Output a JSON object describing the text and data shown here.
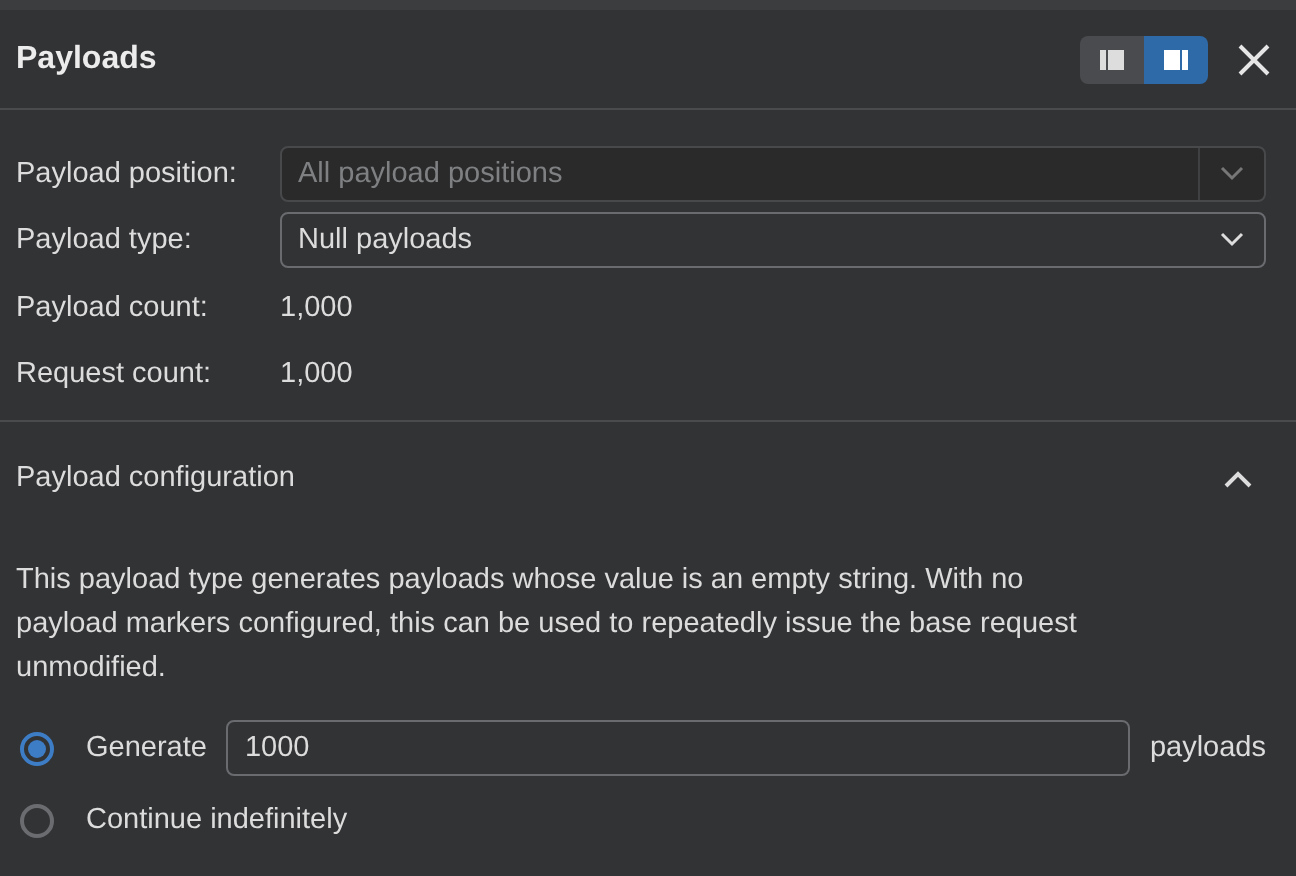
{
  "panel": {
    "title": "Payloads",
    "view_toggle": [
      {
        "selected": false
      },
      {
        "selected": true
      }
    ]
  },
  "fields": [
    {
      "kind": "select",
      "label": "Payload position:",
      "value": "All payload positions",
      "disabled": true
    },
    {
      "kind": "select",
      "label": "Payload type:",
      "value": "Null payloads",
      "disabled": false
    },
    {
      "kind": "text",
      "label": "Payload count:",
      "value": "1,000"
    },
    {
      "kind": "text",
      "label": "Request count:",
      "value": "1,000"
    }
  ],
  "section": {
    "title": "Payload configuration",
    "expanded": true,
    "description": "This payload type generates payloads whose value is an empty string. With no payload markers configured, this can be used to repeatedly issue the base request unmodified.",
    "options": [
      {
        "label": "Generate",
        "selected": true,
        "value": "1000",
        "suffix": "payloads"
      },
      {
        "label": "Continue indefinitely",
        "selected": false
      }
    ]
  }
}
